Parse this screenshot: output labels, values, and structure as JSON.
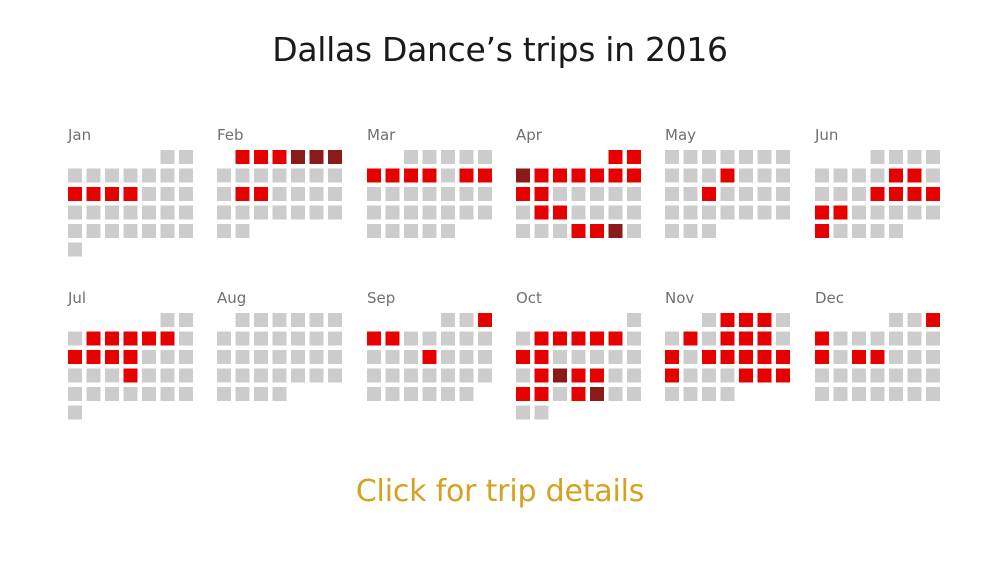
{
  "title": "Dallas Dance’s trips in 2016",
  "cta_label": "Click for trip details",
  "colors": {
    "no_trip": "#cccccc",
    "trip": "#e60000",
    "multi_trip": "#8b1a1a"
  },
  "chart_data": {
    "type": "heatmap",
    "year": 2016,
    "months": [
      {
        "name": "Jan",
        "first_weekday": 5,
        "days": 31,
        "trip_days": [
          10,
          11,
          12,
          13
        ],
        "multi_trip_days": []
      },
      {
        "name": "Feb",
        "first_weekday": 1,
        "days": 29,
        "trip_days": [
          1,
          2,
          3,
          15,
          16
        ],
        "multi_trip_days": [
          4,
          5,
          6
        ]
      },
      {
        "name": "Mar",
        "first_weekday": 2,
        "days": 31,
        "trip_days": [
          6,
          7,
          8,
          9,
          11,
          12
        ],
        "multi_trip_days": []
      },
      {
        "name": "Apr",
        "first_weekday": 5,
        "days": 30,
        "trip_days": [
          1,
          2,
          4,
          5,
          6,
          7,
          8,
          9,
          10,
          11,
          18,
          19,
          27,
          28
        ],
        "multi_trip_days": [
          3,
          29
        ]
      },
      {
        "name": "May",
        "first_weekday": 0,
        "days": 31,
        "trip_days": [
          11,
          17
        ],
        "multi_trip_days": []
      },
      {
        "name": "Jun",
        "first_weekday": 3,
        "days": 30,
        "trip_days": [
          9,
          10,
          15,
          16,
          17,
          18,
          19,
          20,
          26
        ],
        "multi_trip_days": []
      },
      {
        "name": "Jul",
        "first_weekday": 5,
        "days": 31,
        "trip_days": [
          4,
          5,
          6,
          7,
          8,
          10,
          11,
          12,
          13,
          20
        ],
        "multi_trip_days": []
      },
      {
        "name": "Aug",
        "first_weekday": 1,
        "days": 31,
        "trip_days": [],
        "multi_trip_days": []
      },
      {
        "name": "Sep",
        "first_weekday": 4,
        "days": 30,
        "trip_days": [
          3,
          4,
          5,
          14
        ],
        "multi_trip_days": []
      },
      {
        "name": "Oct",
        "first_weekday": 6,
        "days": 31,
        "trip_days": [
          3,
          4,
          5,
          6,
          7,
          9,
          10,
          17,
          19,
          20,
          23,
          24,
          26
        ],
        "multi_trip_days": [
          18,
          27
        ]
      },
      {
        "name": "Nov",
        "first_weekday": 2,
        "days": 30,
        "trip_days": [
          2,
          3,
          4,
          7,
          9,
          10,
          11,
          13,
          15,
          16,
          17,
          18,
          19,
          20,
          24,
          25,
          26
        ],
        "multi_trip_days": []
      },
      {
        "name": "Dec",
        "first_weekday": 4,
        "days": 31,
        "trip_days": [
          3,
          4,
          11,
          13,
          14
        ],
        "multi_trip_days": []
      }
    ]
  }
}
